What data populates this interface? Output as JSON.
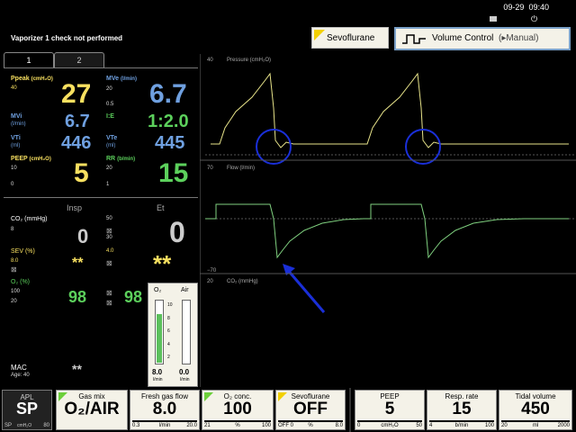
{
  "topbar": {
    "date": "09-29",
    "time": "09:40"
  },
  "alarm_message": "Vaporizer 1 check not performed",
  "agent_button": {
    "label": "Sevoflurane"
  },
  "mode_button": {
    "label": "Volume Control",
    "sub": "(▸Manual)"
  },
  "tabs": [
    "1",
    "2"
  ],
  "params": {
    "ppeak": {
      "label": "Ppeak",
      "unit": "(cmH₂O)",
      "limit": "40",
      "value": "27"
    },
    "mve": {
      "label": "MVe",
      "unit": "(l/min)",
      "limit_hi": "20",
      "limit_lo": "0.5",
      "value": "6.7"
    },
    "mvi": {
      "label": "MVi",
      "unit": "(l/min)",
      "value": "6.7"
    },
    "ie": {
      "label": "I:E",
      "value": "1:2.0"
    },
    "vti": {
      "label": "VTi",
      "unit": "(ml)",
      "value": "446"
    },
    "vte": {
      "label": "VTe",
      "unit": "(ml)",
      "value": "445"
    },
    "peep": {
      "label": "PEEP",
      "unit": "(cmH₂O)",
      "limit_hi": "10",
      "limit_lo": "0",
      "value": "5"
    },
    "rr": {
      "label": "RR",
      "unit": "(b/min)",
      "limit_hi": "20",
      "limit_lo": "1",
      "value": "15"
    }
  },
  "gas": {
    "insp_header": "Insp",
    "et_header": "Et",
    "co2": {
      "label": "CO₂ (mmHg)",
      "insp_limit": "8",
      "et_limit": "50",
      "et_limit_lo": "30",
      "insp": "0",
      "et": "0"
    },
    "sev": {
      "label": "SEV (%)",
      "insp_limit": "8.0",
      "et_limit": "4.0",
      "insp": "**",
      "et": "**"
    },
    "o2": {
      "label": "O₂ (%)",
      "insp_limit": "100",
      "insp_limit_lo": "20",
      "insp": "98",
      "et": "98"
    },
    "mac": {
      "label": "MAC",
      "age": "Age: 40",
      "value": "**"
    }
  },
  "flowmeter": {
    "o2_label": "O₂",
    "air_label": "Air",
    "o2_value": "8.0",
    "air_value": "0.0",
    "unit": "l/min",
    "scale": [
      "10",
      "8",
      "6",
      "4",
      "2"
    ],
    "o2_level": 0.8,
    "air_level": 0.0
  },
  "waveforms": {
    "pressure": {
      "top": "40",
      "label": "Pressure (cmH₂O)"
    },
    "flow": {
      "top": "70",
      "label": "Flow (l/min)",
      "bottom": "−70"
    },
    "co2": {
      "top": "20",
      "label": "CO₂ (mmHg)"
    }
  },
  "bottom": {
    "apl": {
      "label": "APL",
      "value": "SP",
      "min": "SP",
      "unit": "cmH₂O",
      "max": "80"
    },
    "gas_mix": {
      "title": "Gas mix",
      "value": "O₂/AIR"
    },
    "fresh_gas": {
      "title": "Fresh gas flow",
      "value": "8.0",
      "min": "0.3",
      "unit": "l/min",
      "max": "20.0"
    },
    "o2_conc": {
      "title": "O₂ conc.",
      "value": "100",
      "min": "21",
      "unit": "%",
      "max": "100"
    },
    "sevo": {
      "title": "Sevoflurane",
      "value": "OFF",
      "min": "OFF",
      "mid": "0",
      "unit": "%",
      "max": "8.0"
    },
    "peep": {
      "title": "PEEP",
      "value": "5",
      "min": "0",
      "unit": "cmH₂O",
      "max": "50"
    },
    "resp_rate": {
      "title": "Resp. rate",
      "value": "15",
      "min": "4",
      "unit": "b/min",
      "max": "100"
    },
    "tidal": {
      "title": "Tidal volume",
      "value": "450",
      "min": "20",
      "unit": "ml",
      "max": "2000"
    }
  },
  "colors": {
    "yellow": "#f8e060",
    "blue": "#6fa0e0",
    "green": "#5cd05c",
    "annotation": "#1a2fd8"
  }
}
